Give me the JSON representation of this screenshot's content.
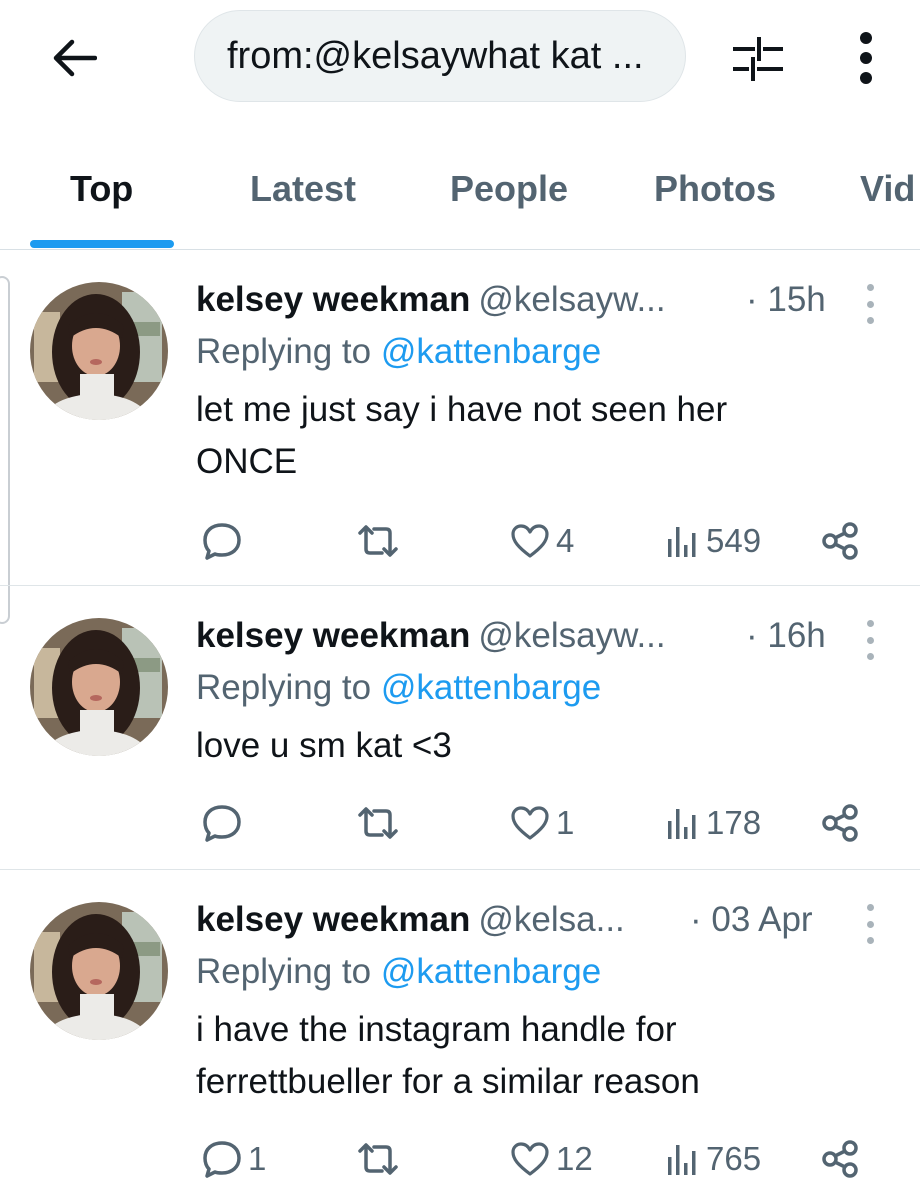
{
  "header": {
    "back_icon": "arrow-left-icon",
    "search_query": "from:@kelsaywhat kat ...",
    "filter_icon": "sliders-icon",
    "more_icon": "more-vertical-icon"
  },
  "tabs": [
    {
      "label": "Top",
      "active": true
    },
    {
      "label": "Latest",
      "active": false
    },
    {
      "label": "People",
      "active": false
    },
    {
      "label": "Photos",
      "active": false
    },
    {
      "label": "Vid",
      "active": false
    }
  ],
  "colors": {
    "accent": "#1d9bf0",
    "text_primary": "#0f1419",
    "text_secondary": "#536471",
    "search_bg": "#eff3f4"
  },
  "tweets": [
    {
      "author_name": "kelsey weekman",
      "author_handle": "@kelsayw...",
      "timestamp": "· 15h",
      "replying_prefix": "Replying to",
      "replying_to": "@kattenbarge",
      "text": "let me just say i have not seen her ONCE",
      "replies": "",
      "retweets": "",
      "likes": "4",
      "views": "549"
    },
    {
      "author_name": "kelsey weekman",
      "author_handle": "@kelsayw...",
      "timestamp": "· 16h",
      "replying_prefix": "Replying to",
      "replying_to": "@kattenbarge",
      "text": "love u sm kat <3",
      "replies": "",
      "retweets": "",
      "likes": "1",
      "views": "178"
    },
    {
      "author_name": "kelsey weekman",
      "author_handle": "@kelsa...",
      "timestamp": "· 03 Apr",
      "replying_prefix": "Replying to",
      "replying_to": "@kattenbarge",
      "text": "i have the instagram handle for ferrettbueller for a similar reason",
      "replies": "1",
      "retweets": "",
      "likes": "12",
      "views": "765"
    }
  ]
}
